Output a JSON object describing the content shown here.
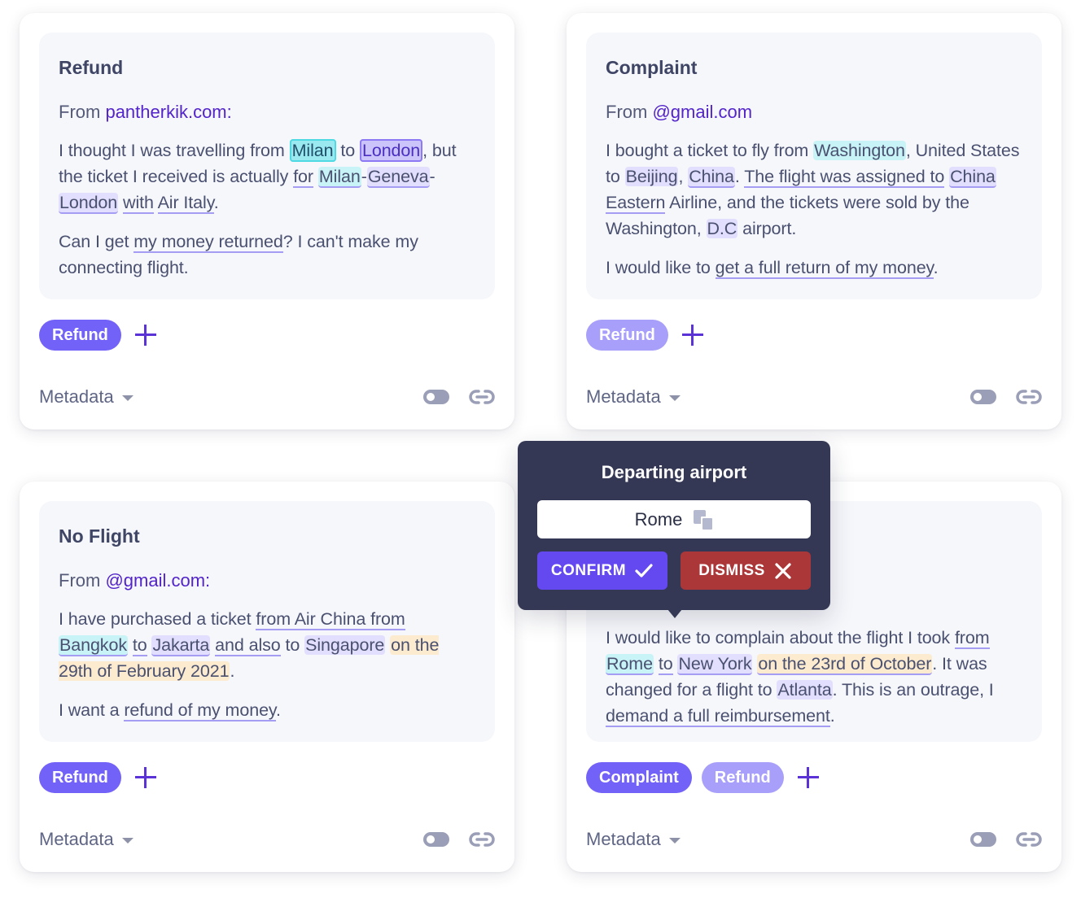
{
  "colors": {
    "accent": "#7362f7",
    "accent_light": "#a79ffa",
    "popover_bg": "#343854",
    "confirm": "#6448f0",
    "dismiss": "#ab3739",
    "highlight_cyan": "#c9f4f7",
    "highlight_purple": "#e2defd",
    "highlight_orange": "#fcebcf"
  },
  "cards": [
    {
      "title": "Refund",
      "from_label": "From",
      "from_domain": "pantherkik.com:",
      "body": {
        "p1": [
          "I thought I was travelling from ",
          "Milan",
          "to",
          "London",
          ",",
          " but the ticket I received is actually ",
          "for",
          " ",
          "Milan",
          "-",
          "Geneva",
          "-",
          "London",
          " ",
          "with",
          " ",
          "Air Italy",
          "."
        ],
        "p2": [
          "Can I get ",
          "my money returned",
          "? I can't make my connecting flight."
        ]
      },
      "tags": [
        {
          "label": "Refund",
          "state": "active"
        }
      ],
      "add_tag_icon": "plus-icon",
      "metadata_label": "Metadata"
    },
    {
      "title": "Complaint",
      "from_label": "From",
      "from_domain": "@gmail.com",
      "body": {
        "p1": [
          "I bought a ticket to fly from ",
          "Washington",
          ", United States to ",
          "Beijing",
          ", ",
          "China",
          ". ",
          "The flight was assigned to",
          " ",
          "China",
          " ",
          "Eastern",
          " Airline, and the tickets were sold by the Washington, ",
          "D.C",
          " airport."
        ],
        "p2": [
          "I would like to ",
          "get a full return of my money",
          "."
        ]
      },
      "tags": [
        {
          "label": "Refund",
          "state": "inactive"
        }
      ],
      "add_tag_icon": "plus-icon",
      "metadata_label": "Metadata"
    },
    {
      "title": "No Flight",
      "from_label": "From",
      "from_domain": "@gmail.com:",
      "body": {
        "p1": [
          "I have purchased a ticket ",
          "from Air China from",
          " ",
          "Bangkok",
          " ",
          "to",
          " ",
          "Jakarta",
          " ",
          "and also",
          " to ",
          "Singapore",
          " ",
          "on the 29th of February 2021",
          "."
        ],
        "p2": [
          "I want a ",
          "refund of my money",
          "."
        ]
      },
      "tags": [
        {
          "label": "Refund",
          "state": "active"
        }
      ],
      "add_tag_icon": "plus-icon",
      "metadata_label": "Metadata"
    },
    {
      "title": "",
      "body": {
        "p1": [
          "I would like to complain about the flight I took ",
          "from",
          " ",
          "Rome",
          " ",
          "to",
          " ",
          "New York",
          " ",
          "on the 23rd of October",
          ". It was changed for a flight to ",
          "Atlanta",
          ". This is an outrage, I ",
          "demand a full reimbursement",
          "."
        ]
      },
      "tags": [
        {
          "label": "Complaint",
          "state": "active"
        },
        {
          "label": "Refund",
          "state": "inactive"
        }
      ],
      "add_tag_icon": "plus-icon",
      "metadata_label": "Metadata"
    }
  ],
  "popover": {
    "title": "Departing airport",
    "value": "Rome",
    "confirm_label": "CONFIRM",
    "dismiss_label": "DISMISS"
  }
}
